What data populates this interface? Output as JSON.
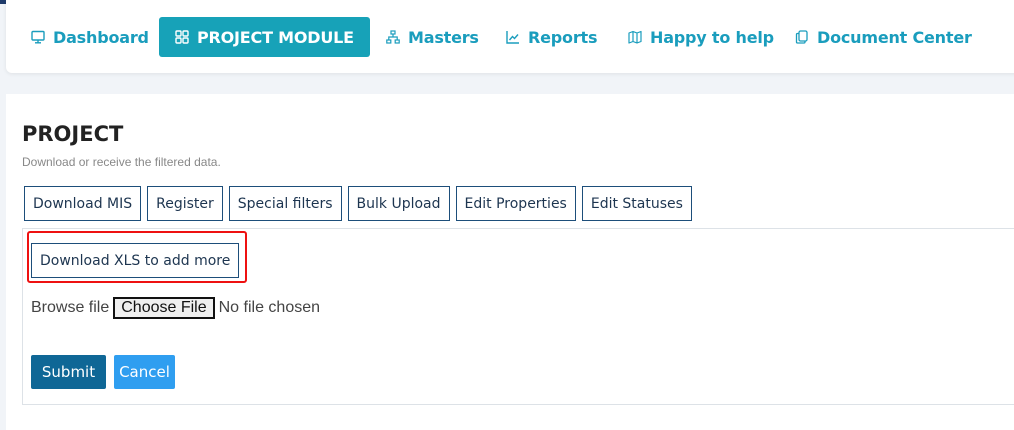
{
  "nav": {
    "items": [
      {
        "label": "Dashboard",
        "icon": "monitor-icon"
      },
      {
        "label": "PROJECT MODULE",
        "icon": "grid-icon",
        "active": true
      },
      {
        "label": "Masters",
        "icon": "sitemap-icon"
      },
      {
        "label": "Reports",
        "icon": "chart-line-icon"
      },
      {
        "label": "Happy to help",
        "icon": "map-icon"
      },
      {
        "label": "Document Center",
        "icon": "documents-icon"
      }
    ]
  },
  "page": {
    "title": "PROJECT",
    "subtitle": "Download or receive the filtered data."
  },
  "toolbar": {
    "buttons": [
      "Download MIS",
      "Register",
      "Special filters",
      "Bulk Upload",
      "Edit Properties",
      "Edit Statuses"
    ]
  },
  "upload": {
    "download_xls_label": "Download XLS to add more",
    "browse_label": "Browse file",
    "choose_file_label": "Choose File",
    "no_file_text": "No file chosen",
    "submit_label": "Submit",
    "cancel_label": "Cancel"
  },
  "colors": {
    "nav_text": "#1a9dbd",
    "nav_active_bg": "#17a2b8",
    "submit_bg": "#0f6796",
    "cancel_bg": "#2f9ef0",
    "highlight": "#ee1111"
  }
}
